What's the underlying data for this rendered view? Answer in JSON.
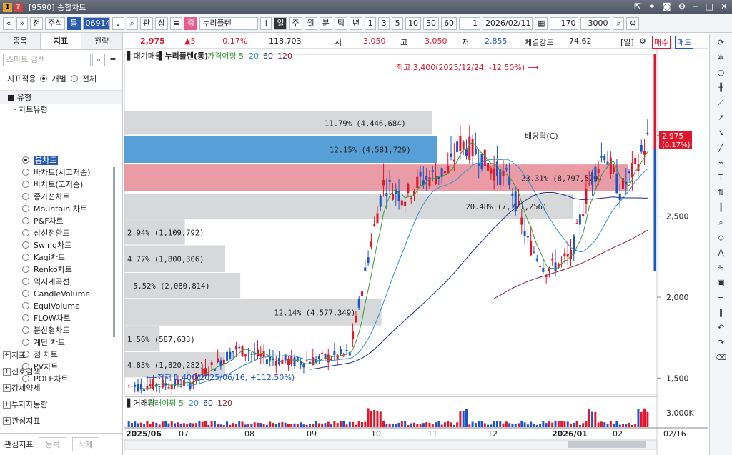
{
  "window": {
    "title": "[9590] 종합차트",
    "icon_label": "1"
  },
  "toolbar": {
    "market": "주식",
    "tong": "통",
    "code": "069140",
    "search_btn": "⌕",
    "btn_gwan": "관",
    "btn_sang": "상",
    "jeung": "증",
    "stock_name": "누리플렌",
    "info_btn": "i",
    "periods": [
      "일",
      "주",
      "월",
      "분",
      "틱",
      "년"
    ],
    "active_period": "일",
    "minutes": [
      "1",
      "3",
      "5",
      "10",
      "30",
      "60"
    ],
    "count_sel": "1",
    "date": "2026/02/11",
    "bars_label": "170",
    "zoom_label": "3000",
    "arrows": [
      "«",
      "»"
    ],
    "jeon": "전"
  },
  "left": {
    "tabs": [
      "종목",
      "지표",
      "전략"
    ],
    "active_tab": "지표",
    "search_placeholder": "스마트 검색",
    "apply_label": "지표적용",
    "apply_opts": [
      "개별",
      "전체"
    ],
    "section": "유형",
    "sub": "차트유형",
    "chart_types": [
      "봉차트",
      "바차트(시고저종)",
      "바차트(고저종)",
      "종가선차트",
      "Mountain 차트",
      "P&F차트",
      "삼선전환도",
      "Swing차트",
      "Kagi차트",
      "Renko차트",
      "역시계곡선",
      "CandleVolume",
      "EquiVolume",
      "FLOW차트",
      "분산형차트",
      "계단 차트",
      "점 차트",
      "PV차트",
      "POLE차트"
    ],
    "selected_type": "봉차트",
    "groups": [
      "지표",
      "신호검색",
      "강세약세",
      "투자자동향",
      "관심지표"
    ],
    "bottom": {
      "label": "관심지표",
      "btn1": "등록",
      "btn2": "삭제"
    }
  },
  "infobar": {
    "price": "2,975",
    "change": "▲5",
    "pct": "+0.17%",
    "volume": "118,703",
    "open_label": "시",
    "open": "3,050",
    "high_label": "고",
    "high": "3,050",
    "low_label": "저",
    "low": "2,855",
    "strength_label": "체결강도",
    "strength": "74.62",
    "unit": "[일]",
    "buy": "매수",
    "sell": "매도"
  },
  "chart_data": {
    "type": "candlestick",
    "legend": [
      "대기매물",
      "누리플렌(통)",
      "가격이평 5",
      "20",
      "60",
      "120"
    ],
    "yticks": [
      "3,000",
      "2,500",
      "2,000",
      "1,500"
    ],
    "ylim": [
      1400,
      3500
    ],
    "xticks": [
      "2025/06",
      "07",
      "08",
      "09",
      "10",
      "11",
      "12",
      "2026/01",
      "02",
      "02/16"
    ],
    "profile": [
      {
        "label": "11.79% (4,446,684)",
        "low": 3000,
        "high": 3150,
        "frac": 0.61
      },
      {
        "label": "12.15% (4,581,729)",
        "low": 2825,
        "high": 2995,
        "frac": 0.62
      },
      {
        "label": "23.31% (8,797,579)",
        "low": 2650,
        "high": 2820,
        "frac": 1.0
      },
      {
        "label": "20.48% (7,721,256)",
        "low": 2480,
        "high": 2640,
        "frac": 0.89
      },
      {
        "label": "2.94% (1,109,792)",
        "low": 2320,
        "high": 2480,
        "frac": 0.12
      },
      {
        "label": "4.77% (1,800,306)",
        "low": 2150,
        "high": 2320,
        "frac": 0.2
      },
      {
        "label": "5.52% (2,080,814)",
        "low": 1990,
        "high": 2150,
        "frac": 0.23
      },
      {
        "label": "12.14% (4,577,349)",
        "low": 1820,
        "high": 1990,
        "frac": 0.51
      },
      {
        "label": "1.56% (587,633)",
        "low": 1660,
        "high": 1820,
        "frac": 0.07
      },
      {
        "label": "4.83% (1,820,282)",
        "low": 1500,
        "high": 1660,
        "frac": 0.2
      }
    ],
    "high_note": "최고 3,400(2025/12/24, -12.50%)",
    "low_note": "최저 1,400(2025/06/16, +112.50%)",
    "price_tag": "2,975",
    "price_tag_pct": "(0.17%)",
    "dividend_note": "배당락(C)",
    "volume_legend": [
      "거래량",
      "거래이평 5",
      "20",
      "60",
      "120"
    ],
    "volume_tick": "3,000K"
  }
}
